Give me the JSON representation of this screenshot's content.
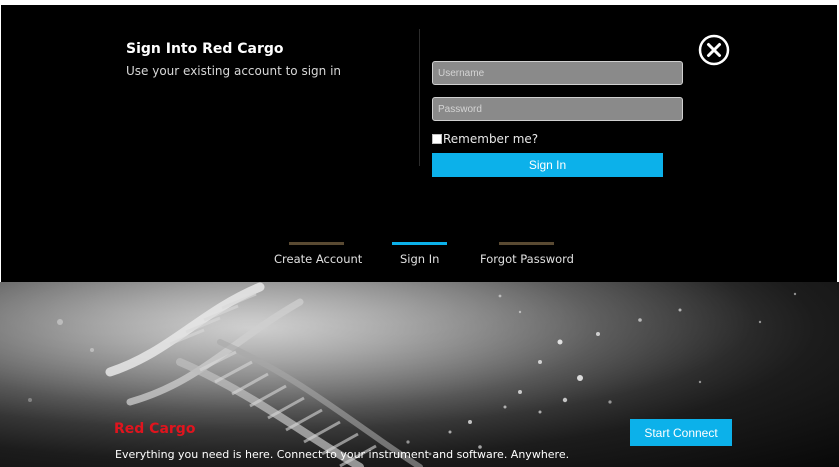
{
  "signin": {
    "title": "Sign Into Red Cargo",
    "subtitle": "Use your existing account to sign in",
    "username_placeholder": "Username",
    "password_placeholder": "Password",
    "remember_label": "Remember me?",
    "submit_label": "Sign In",
    "close_icon": "close-icon"
  },
  "tabs": [
    {
      "label": "Create Account",
      "indicator_color": "#5a4a32",
      "active": false
    },
    {
      "label": "Sign In",
      "indicator_color": "#0cb1ea",
      "active": true
    },
    {
      "label": "Forgot Password",
      "indicator_color": "#5a4a32",
      "active": false
    }
  ],
  "hero": {
    "brand": "Red Cargo",
    "tagline": "Everything you need is here. Connect to your instrument and software. Anywhere.",
    "cta_label": "Start Connect",
    "image": "dna-helix-image"
  },
  "colors": {
    "accent": "#0cb1ea",
    "brand": "#e0141e",
    "modal_bg": "#000000"
  }
}
